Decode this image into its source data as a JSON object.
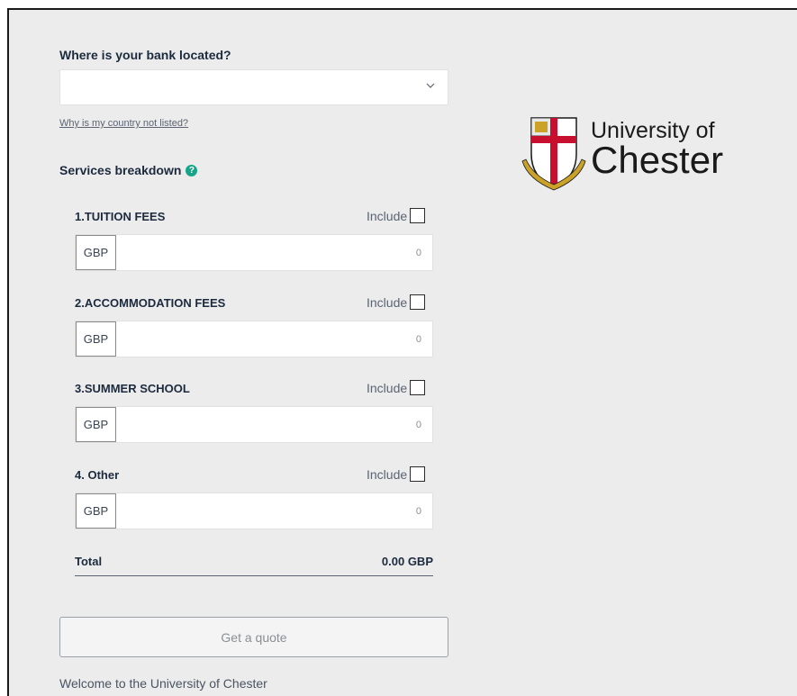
{
  "form": {
    "bank_location_label": "Where is your bank located?",
    "bank_location_value": "",
    "why_not_listed": "Why is my country not listed?",
    "services_title": "Services breakdown",
    "help_icon": "?",
    "include_label": "Include",
    "services": [
      {
        "title": "1.TUITION FEES",
        "currency": "GBP",
        "amount": "0",
        "included": false
      },
      {
        "title": "2.ACCOMMODATION FEES",
        "currency": "GBP",
        "amount": "0",
        "included": false
      },
      {
        "title": "3.SUMMER SCHOOL",
        "currency": "GBP",
        "amount": "0",
        "included": false
      },
      {
        "title": "4. Other",
        "currency": "GBP",
        "amount": "0",
        "included": false
      }
    ],
    "total_label": "Total",
    "total_value": "0.00 GBP",
    "quote_button": "Get a quote",
    "welcome_text": "Welcome to the University of Chester"
  },
  "brand": {
    "logo_line1": "University of",
    "logo_line2": "Chester",
    "accent_color": "#17a589",
    "crest_red": "#c8102e",
    "crest_gold": "#c9a227"
  },
  "icons": {
    "dropdown": "chevron-down-icon",
    "help": "question-circle-icon",
    "crest": "university-crest-icon"
  }
}
